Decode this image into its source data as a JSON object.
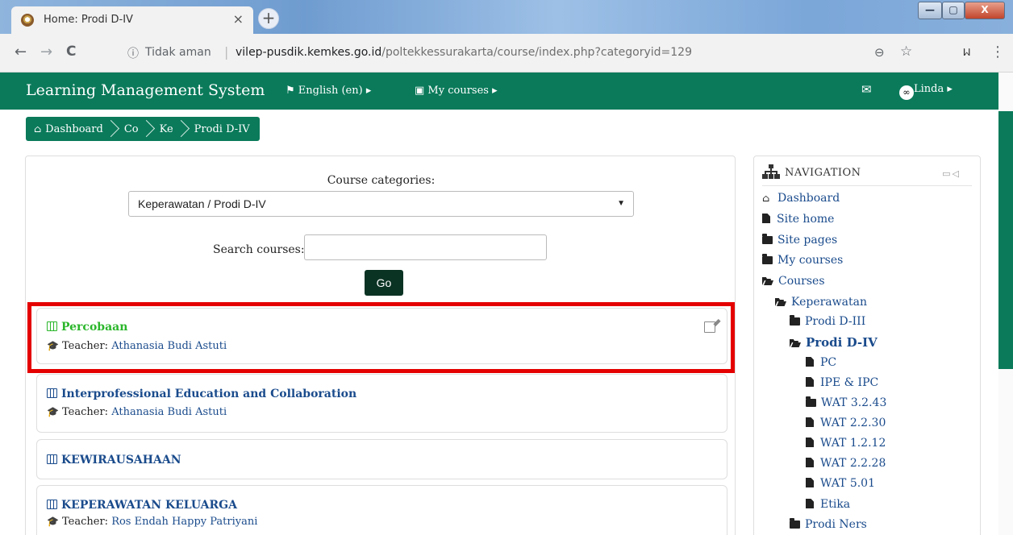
{
  "browser": {
    "tab_title": "Home: Prodi D-IV",
    "tab_close": "×",
    "new_tab": "+",
    "insecure_label": "Tidak aman",
    "url_host": "vilep-pusdik.kemkes.go.id",
    "url_path": "/poltekkessurakarta/course/index.php?categoryid=129",
    "back": "←",
    "forward": "→",
    "reload": "C",
    "info_icon": "ⓘ",
    "zoom_icon": "⊖",
    "star_icon": "☆",
    "profile_text": "ᥕ",
    "menu_icon": "⋮",
    "win_min": "—",
    "win_max": "▢",
    "win_close": "X"
  },
  "navbar": {
    "brand": "Learning Management System",
    "language": "English (en)",
    "my_courses": "My courses",
    "user": "Linda",
    "colors": {
      "primary": "#0a7a5a"
    }
  },
  "breadcrumb": {
    "items": [
      "Dashboard",
      "Co",
      "Ke",
      "Prodi D-IV"
    ]
  },
  "main": {
    "categories_label": "Course categories:",
    "category_selected": "Keperawatan / Prodi D-IV",
    "search_label": "Search courses:",
    "search_value": "",
    "go_label": "Go",
    "teacher_prefix": "Teacher:",
    "courses": [
      {
        "title": "Percobaan",
        "teacher": "Athanasia Budi Astuti"
      },
      {
        "title": "Interprofessional Education and Collaboration",
        "teacher": "Athanasia Budi Astuti"
      },
      {
        "title": "KEWIRAUSAHAAN"
      },
      {
        "title": "KEPERAWATAN KELUARGA",
        "teacher": "Ros Endah Happy Patriyani"
      }
    ]
  },
  "navigation": {
    "header": "NAVIGATION",
    "controls": "▭◁",
    "items": [
      {
        "label": "Dashboard"
      },
      {
        "label": "Site home"
      },
      {
        "label": "Site pages"
      },
      {
        "label": "My courses"
      },
      {
        "label": "Courses"
      },
      {
        "label": "Keperawatan"
      },
      {
        "label": "Prodi D-III"
      },
      {
        "label": "Prodi D-IV"
      },
      {
        "label": "PC"
      },
      {
        "label": "IPE & IPC"
      },
      {
        "label": "WAT 3.2.43"
      },
      {
        "label": "WAT 2.2.30"
      },
      {
        "label": "WAT 1.2.12"
      },
      {
        "label": "WAT 2.2.28"
      },
      {
        "label": "WAT 5.01"
      },
      {
        "label": "Etika"
      },
      {
        "label": "Prodi Ners"
      }
    ]
  }
}
